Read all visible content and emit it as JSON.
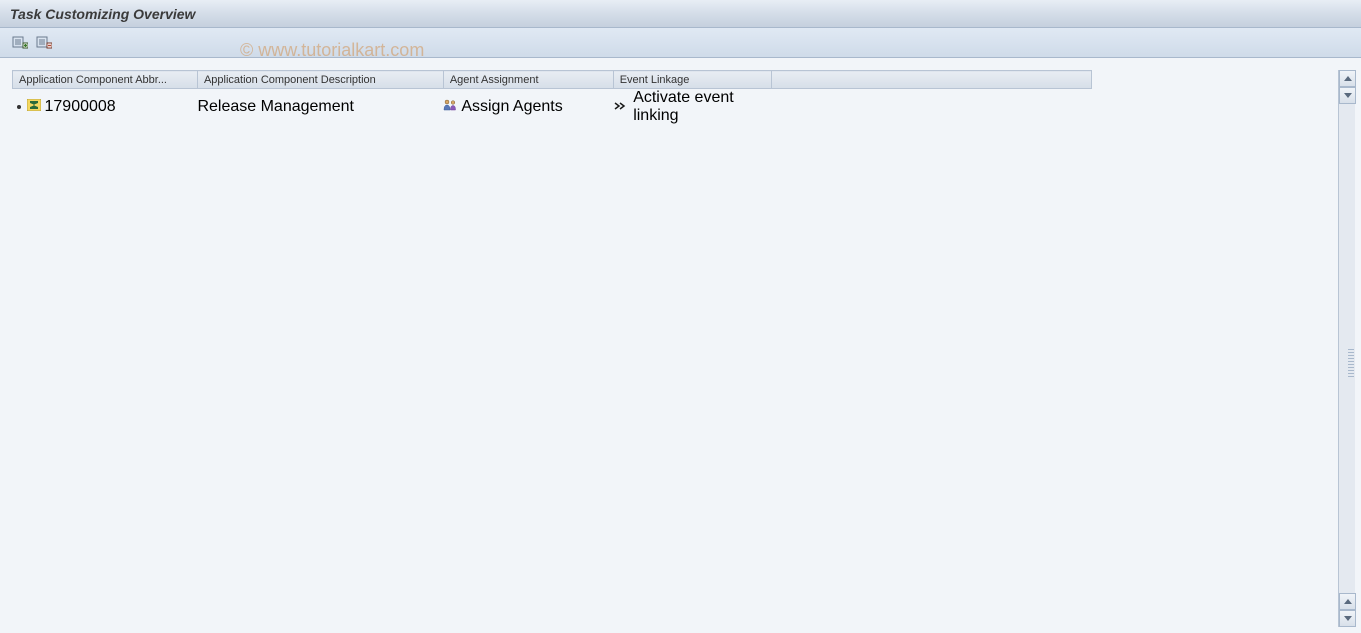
{
  "title": "Task Customizing Overview",
  "watermark": "© www.tutorialkart.com",
  "table": {
    "headers": {
      "col1": "Application Component Abbr...",
      "col2": "Application Component Description",
      "col3": "Agent Assignment",
      "col4": "Event Linkage",
      "col5": ""
    },
    "rows": [
      {
        "abbrev": "17900008",
        "description": "Release Management",
        "agent": "Assign Agents",
        "event": "Activate event linking"
      }
    ]
  }
}
